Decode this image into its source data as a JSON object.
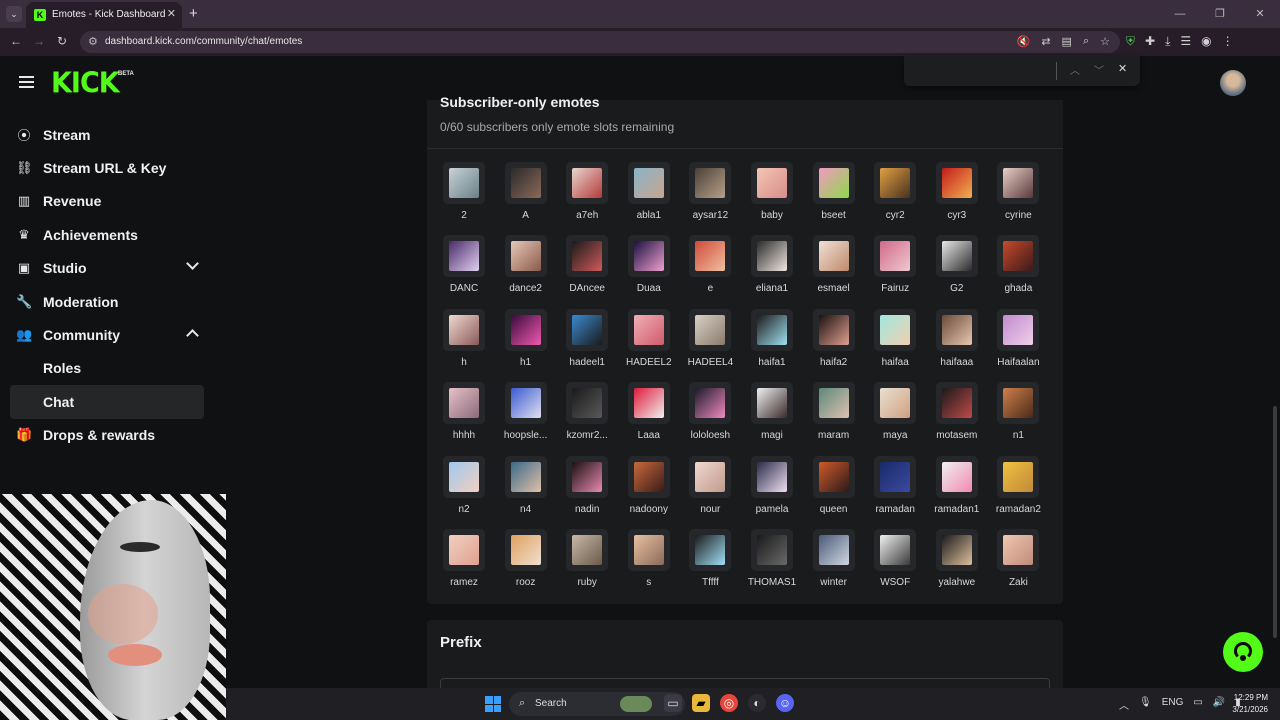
{
  "browser": {
    "tab_title": "Emotes - Kick Dashboard",
    "url": "dashboard.kick.com/community/chat/emotes"
  },
  "brand": {
    "logo": "KICK",
    "badge": "BETA",
    "accent": "#53fc18"
  },
  "sidebar": {
    "items": [
      {
        "label": "Stream",
        "icon": "broadcast-icon"
      },
      {
        "label": "Stream URL & Key",
        "icon": "link-icon"
      },
      {
        "label": "Revenue",
        "icon": "chart-icon"
      },
      {
        "label": "Achievements",
        "icon": "trophy-icon"
      },
      {
        "label": "Studio",
        "icon": "studio-icon"
      },
      {
        "label": "Moderation",
        "icon": "wrench-icon"
      },
      {
        "label": "Community",
        "icon": "users-icon"
      }
    ],
    "sub_items": [
      {
        "label": "Roles"
      },
      {
        "label": "Chat"
      }
    ],
    "drops": {
      "label": "Drops & rewards",
      "icon": "gift-icon"
    }
  },
  "subscriber_panel": {
    "title": "Subscriber-only emotes",
    "subtitle": "0/60 subscribers only emote slots remaining"
  },
  "emotes": [
    {
      "name": "2",
      "c1": "#c8d4d8",
      "c2": "#6a7f88"
    },
    {
      "name": "A",
      "c1": "#2a2a2a",
      "c2": "#8c6a5a"
    },
    {
      "name": "a7eh",
      "c1": "#e7d6cf",
      "c2": "#b43a3a"
    },
    {
      "name": "abla1",
      "c1": "#88b4c8",
      "c2": "#c9a58f"
    },
    {
      "name": "aysar12",
      "c1": "#4a4038",
      "c2": "#b9a08a"
    },
    {
      "name": "baby",
      "c1": "#f2c6b0",
      "c2": "#d88c8c"
    },
    {
      "name": "bseet",
      "c1": "#f29ac2",
      "c2": "#8cd84a"
    },
    {
      "name": "cyr2",
      "c1": "#e0a040",
      "c2": "#4a3020"
    },
    {
      "name": "cyr3",
      "c1": "#c41a1a",
      "c2": "#f0b050"
    },
    {
      "name": "cyrine",
      "c1": "#e8cfc8",
      "c2": "#5a3a3a"
    },
    {
      "name": "DANC",
      "c1": "#4a2a6a",
      "c2": "#e0d0f0"
    },
    {
      "name": "dance2",
      "c1": "#e8c8b8",
      "c2": "#8a5a4a"
    },
    {
      "name": "DAncee",
      "c1": "#1a1a1a",
      "c2": "#d05a5a"
    },
    {
      "name": "Duaa",
      "c1": "#1a1040",
      "c2": "#f0a0d0"
    },
    {
      "name": "e",
      "c1": "#d04a3a",
      "c2": "#f0c0a0"
    },
    {
      "name": "eliana1",
      "c1": "#2a2a2a",
      "c2": "#f0e8e0"
    },
    {
      "name": "esmael",
      "c1": "#f0e0d8",
      "c2": "#c08a6a"
    },
    {
      "name": "Fairuz",
      "c1": "#d06a8a",
      "c2": "#f0c8d0"
    },
    {
      "name": "G2",
      "c1": "#e8e8e8",
      "c2": "#2a2a2a"
    },
    {
      "name": "ghada",
      "c1": "#c84a2a",
      "c2": "#3a1a1a"
    },
    {
      "name": "h",
      "c1": "#f0d8d0",
      "c2": "#8a5a5a"
    },
    {
      "name": "h1",
      "c1": "#3a0a3a",
      "c2": "#f05ab0"
    },
    {
      "name": "hadeel1",
      "c1": "#3a8ad0",
      "c2": "#1a1a1a"
    },
    {
      "name": "HADEEL2",
      "c1": "#f0b0b8",
      "c2": "#d05a6a"
    },
    {
      "name": "HADEEL4",
      "c1": "#d8d0c8",
      "c2": "#8a7a6a"
    },
    {
      "name": "haifa1",
      "c1": "#1a1a1a",
      "c2": "#a0e0f0"
    },
    {
      "name": "haifa2",
      "c1": "#1a1010",
      "c2": "#e0a090"
    },
    {
      "name": "haifaa",
      "c1": "#a0e8e0",
      "c2": "#f0d0b0"
    },
    {
      "name": "haifaaa",
      "c1": "#6a4a3a",
      "c2": "#e8c8b0"
    },
    {
      "name": "Haifaalan",
      "c1": "#c08ad0",
      "c2": "#f0d0e8"
    },
    {
      "name": "hhhh",
      "c1": "#e8c0c8",
      "c2": "#8a6a7a"
    },
    {
      "name": "hoopsle...",
      "c1": "#3a5ad0",
      "c2": "#e0e0f0"
    },
    {
      "name": "kzomr2...",
      "c1": "#1a1a1a",
      "c2": "#5a5a5a"
    },
    {
      "name": "Laaa",
      "c1": "#e01a3a",
      "c2": "#f0f0f0"
    },
    {
      "name": "lololoesh",
      "c1": "#1a1a2a",
      "c2": "#f08ac0"
    },
    {
      "name": "magi",
      "c1": "#f0f0f0",
      "c2": "#3a2a2a"
    },
    {
      "name": "maram",
      "c1": "#5a8a7a",
      "c2": "#e0c0b0"
    },
    {
      "name": "maya",
      "c1": "#e8e0d0",
      "c2": "#d0a080"
    },
    {
      "name": "motasem",
      "c1": "#1a1a1a",
      "c2": "#c04a4a"
    },
    {
      "name": "n1",
      "c1": "#d0804a",
      "c2": "#4a2a1a"
    },
    {
      "name": "n2",
      "c1": "#a0c8f0",
      "c2": "#f0d0c0"
    },
    {
      "name": "n4",
      "c1": "#3a6a8a",
      "c2": "#e0c0a8"
    },
    {
      "name": "nadin",
      "c1": "#1a1010",
      "c2": "#e88ab0"
    },
    {
      "name": "nadoony",
      "c1": "#c86a3a",
      "c2": "#3a1a1a"
    },
    {
      "name": "nour",
      "c1": "#f0d8d0",
      "c2": "#c09a8a"
    },
    {
      "name": "pamela",
      "c1": "#2a2a4a",
      "c2": "#f0e0f0"
    },
    {
      "name": "queen",
      "c1": "#d05a2a",
      "c2": "#2a1a1a"
    },
    {
      "name": "ramadan",
      "c1": "#1a2a6a",
      "c2": "#3a4aa0"
    },
    {
      "name": "ramadan1",
      "c1": "#f0f0f0",
      "c2": "#f08ab0"
    },
    {
      "name": "ramadan2",
      "c1": "#f0c040",
      "c2": "#c08a3a"
    },
    {
      "name": "ramez",
      "c1": "#f0d0c0",
      "c2": "#e0a090"
    },
    {
      "name": "rooz",
      "c1": "#e0a060",
      "c2": "#f0e0d0"
    },
    {
      "name": "ruby",
      "c1": "#c8b8a8",
      "c2": "#6a5a4a"
    },
    {
      "name": "s",
      "c1": "#e8c0a0",
      "c2": "#8a6a5a"
    },
    {
      "name": "Tffff",
      "c1": "#1a1a1a",
      "c2": "#a0e0f8"
    },
    {
      "name": "THOMAS1",
      "c1": "#1a1a1a",
      "c2": "#6a6a6a"
    },
    {
      "name": "winter",
      "c1": "#4a5a7a",
      "c2": "#d0d8e0"
    },
    {
      "name": "WSOF",
      "c1": "#f0f0f0",
      "c2": "#3a3a3a"
    },
    {
      "name": "yalahwe",
      "c1": "#1a1a1a",
      "c2": "#e0c0a0"
    },
    {
      "name": "Zaki",
      "c1": "#f0c8b0",
      "c2": "#c08a7a"
    }
  ],
  "prefix_panel": {
    "title": "Prefix"
  },
  "taskbar": {
    "search_label": "Search",
    "lang": "ENG",
    "time": "12:29 PM",
    "date": "3/21/2026"
  }
}
